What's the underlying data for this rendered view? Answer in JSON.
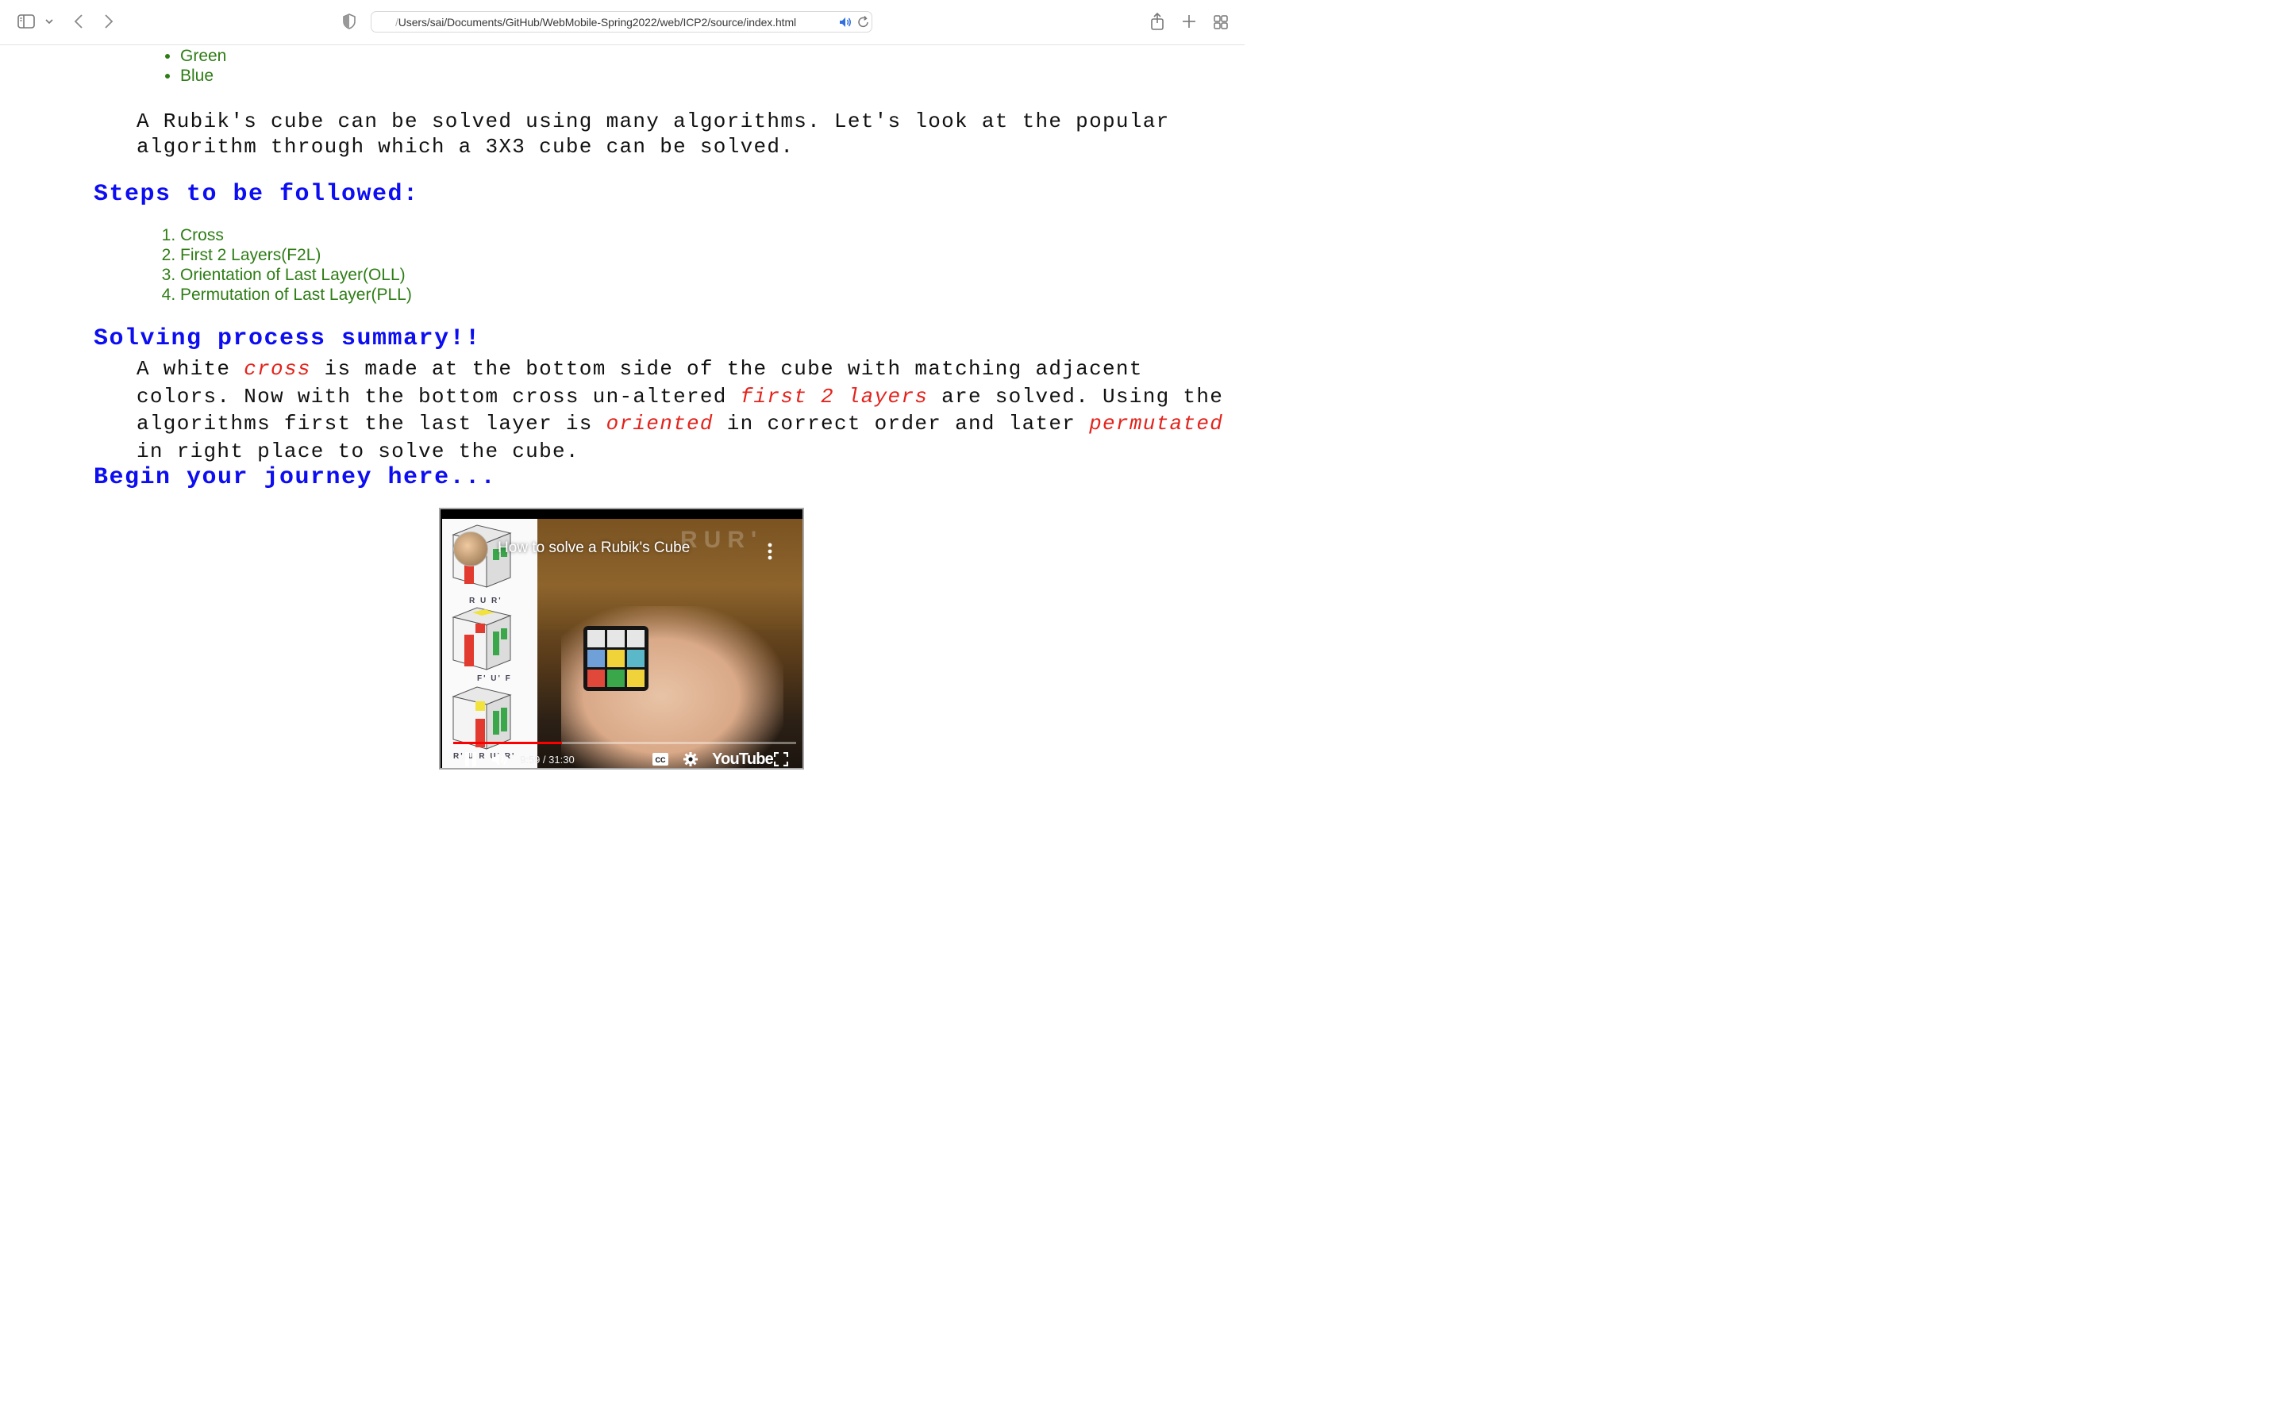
{
  "browser": {
    "url_prefix": "/",
    "url": "Users/sai/Documents/GitHub/WebMobile-Spring2022/web/ICP2/source/index.html",
    "icons": [
      "sidebar-icon",
      "chevron-down-icon",
      "back-icon",
      "forward-icon",
      "shield-icon",
      "speaker-icon",
      "reload-icon",
      "share-icon",
      "plus-icon",
      "tabs-grid-icon"
    ]
  },
  "colors_list": [
    "Green",
    "Blue"
  ],
  "intro": "A Rubik's cube can be solved using many algorithms. Let's look at the popular algorithm through which a 3X3 cube can be solved.",
  "steps": {
    "heading": "Steps to be followed:",
    "items": [
      "Cross",
      "First 2 Layers(F2L)",
      "Orientation of Last Layer(OLL)",
      "Permutation of Last Layer(PLL)"
    ]
  },
  "summary": {
    "heading": "Solving process summary!!",
    "t1": "A white ",
    "e1": "cross",
    "t2": " is made at the bottom side of the cube with matching adjacent colors. Now with the bottom cross un-altered ",
    "e2": "first 2 layers",
    "t3": " are solved. Using the algorithms first the last layer is ",
    "e3": "oriented",
    "t4": " in correct order and later ",
    "e4": "permutated",
    "t5": " in right place to solve the cube."
  },
  "begin_heading": "Begin your journey here...",
  "video": {
    "title": "How to solve a Rubik's Cube",
    "overlay_top": "RUR'",
    "label_1": "R U R'",
    "label_2": "F' U' F",
    "label_3": "R' U R U' R'",
    "time": "9:59 / 31:30",
    "progress": 0.317,
    "brand": "YouTube",
    "colors": {
      "accent": "#ff0000"
    }
  },
  "theme": {
    "list_green": "#2e7d15",
    "heading_blue": "#0d0df2",
    "emphasis_red": "#e3231c"
  }
}
